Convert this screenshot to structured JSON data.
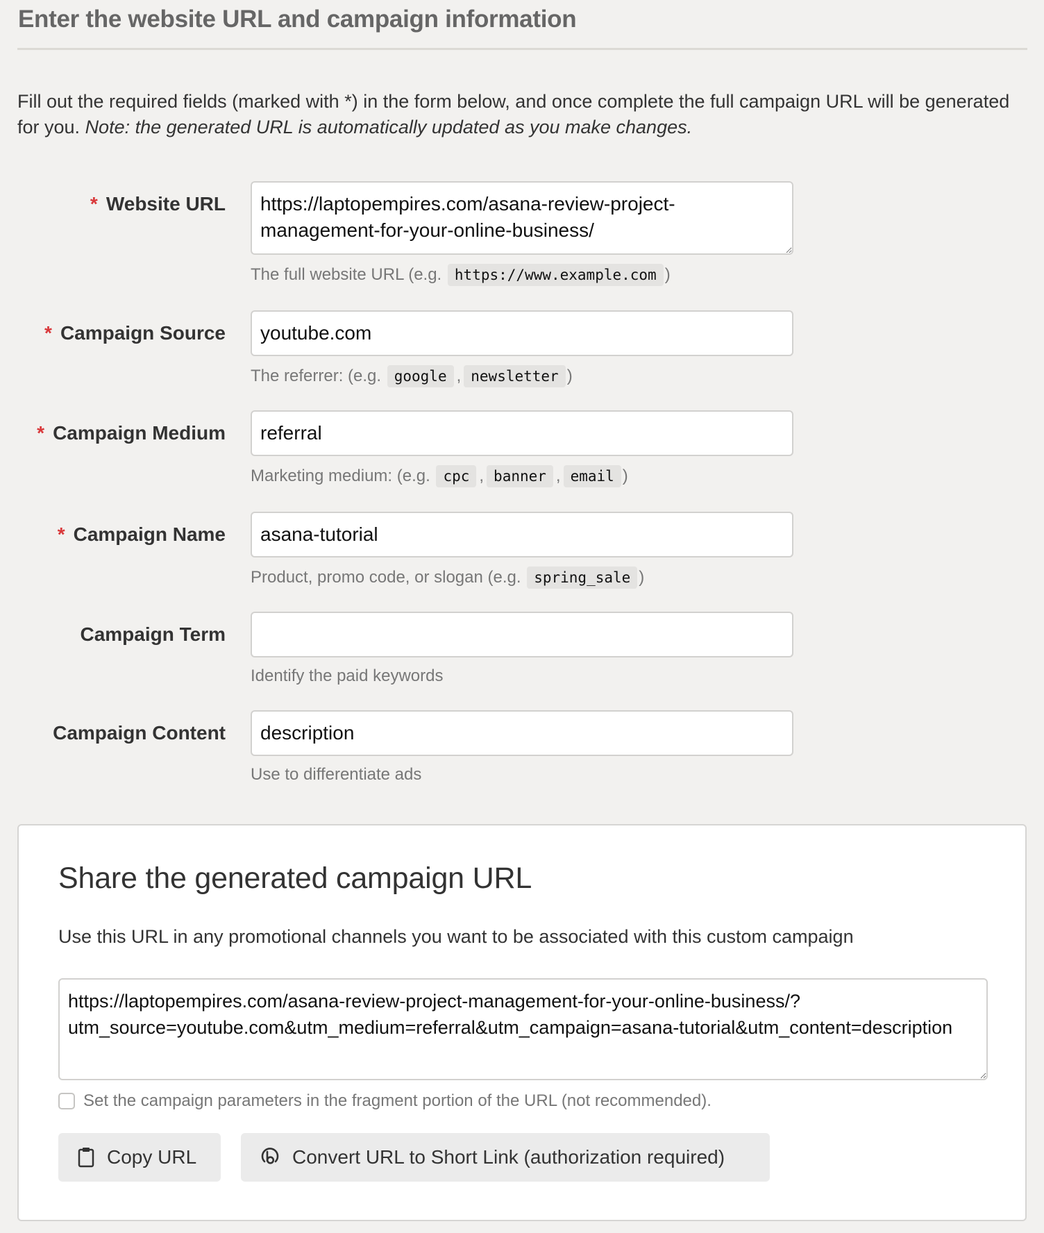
{
  "section": {
    "title": "Enter the website URL and campaign information",
    "intro_text": "Fill out the required fields (marked with *) in the form below, and once complete the full campaign URL will be generated for you.",
    "intro_note": "Note: the generated URL is automatically updated as you make changes."
  },
  "required_marker": "*",
  "fields": {
    "website_url": {
      "label": "Website URL",
      "required": true,
      "value": "https://laptopempires.com/asana-review-project-management-for-your-online-business/",
      "hint_prefix": "The full website URL (e.g.",
      "hint_examples": [
        "https://www.example.com"
      ],
      "hint_suffix": ")"
    },
    "campaign_source": {
      "label": "Campaign Source",
      "required": true,
      "value": "youtube.com",
      "hint_prefix": "The referrer: (e.g.",
      "hint_examples": [
        "google",
        "newsletter"
      ],
      "hint_suffix": ")"
    },
    "campaign_medium": {
      "label": "Campaign Medium",
      "required": true,
      "value": "referral",
      "hint_prefix": "Marketing medium: (e.g.",
      "hint_examples": [
        "cpc",
        "banner",
        "email"
      ],
      "hint_suffix": ")"
    },
    "campaign_name": {
      "label": "Campaign Name",
      "required": true,
      "value": "asana-tutorial",
      "hint_prefix": "Product, promo code, or slogan (e.g.",
      "hint_examples": [
        "spring_sale"
      ],
      "hint_suffix": ")"
    },
    "campaign_term": {
      "label": "Campaign Term",
      "required": false,
      "value": "",
      "hint_prefix": "Identify the paid keywords"
    },
    "campaign_content": {
      "label": "Campaign Content",
      "required": false,
      "value": "description",
      "hint_prefix": "Use to differentiate ads"
    }
  },
  "share": {
    "title": "Share the generated campaign URL",
    "description": "Use this URL in any promotional channels you want to be associated with this custom campaign",
    "generated_url": "https://laptopempires.com/asana-review-project-management-for-your-online-business/?utm_source=youtube.com&utm_medium=referral&utm_campaign=asana-tutorial&utm_content=description",
    "fragment_checkbox_label": "Set the campaign parameters in the fragment portion of the URL (not recommended).",
    "fragment_checked": false,
    "copy_button": {
      "label": "Copy URL",
      "icon": "clipboard-icon"
    },
    "short_link_button": {
      "label": "Convert URL to Short Link (authorization required)",
      "icon": "bitly-icon"
    }
  },
  "colors": {
    "background": "#f2f1ef",
    "required_asterisk": "#d9383a",
    "heading": "#666666",
    "hint_text": "#777777",
    "code_chip_bg": "#e4e3e1",
    "button_bg": "#ebebeb"
  }
}
